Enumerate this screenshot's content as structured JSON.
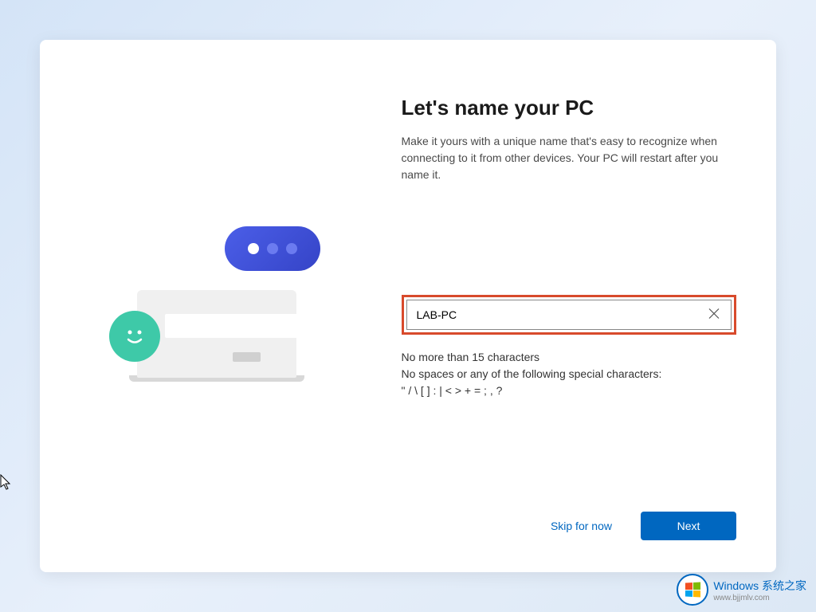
{
  "header": {
    "title": "Let's name your PC",
    "description": "Make it yours with a unique name that's easy to recognize when connecting to it from other devices. Your PC will restart after you name it."
  },
  "input": {
    "value": "LAB-PC",
    "hint_line1": "No more than 15 characters",
    "hint_line2": "No spaces or any of the following special characters:",
    "hint_line3": "\" / \\ [ ] : | < > + = ; , ?"
  },
  "buttons": {
    "skip_label": "Skip for now",
    "next_label": "Next"
  },
  "watermark": {
    "title": "Windows 系统之家",
    "url": "www.bjjmlv.com"
  }
}
